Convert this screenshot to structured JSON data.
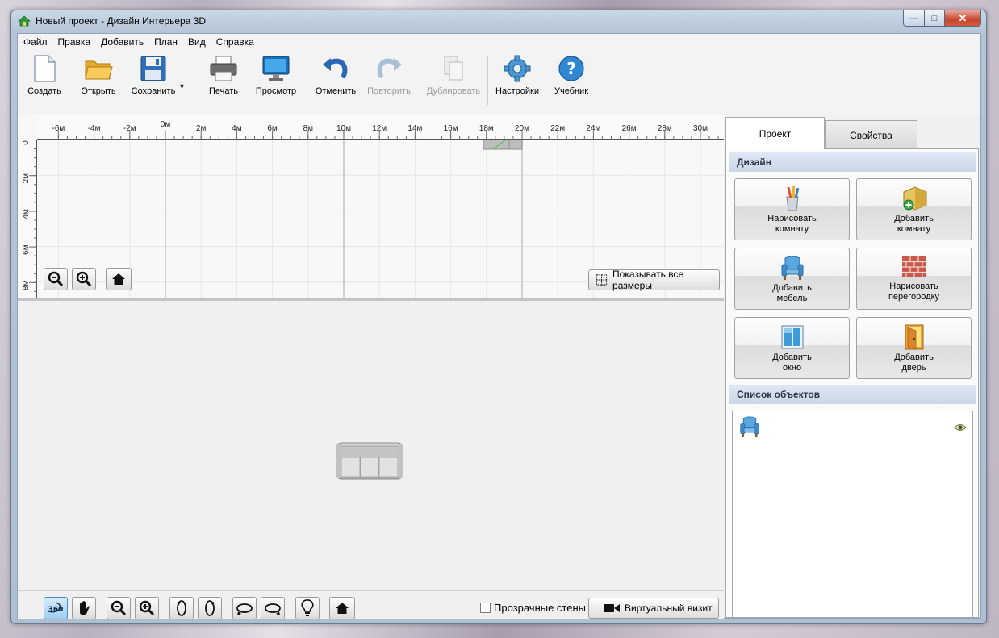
{
  "window": {
    "title": "Новый проект - Дизайн Интерьера 3D"
  },
  "menu": [
    "Файл",
    "Правка",
    "Добавить",
    "План",
    "Вид",
    "Справка"
  ],
  "toolbar": {
    "create": "Создать",
    "open": "Открыть",
    "save": "Сохранить",
    "print": "Печать",
    "preview": "Просмотр",
    "undo": "Отменить",
    "redo": "Повторить",
    "duplicate": "Дублировать",
    "settings": "Настройки",
    "tutorial": "Учебник"
  },
  "plan": {
    "ruler_top": [
      "-6м",
      "-4м",
      "-2м",
      "0м",
      "2м",
      "4м",
      "6м",
      "8м",
      "10м",
      "12м",
      "14м",
      "16м",
      "18м",
      "20м",
      "22м",
      "24м",
      "26м",
      "28м",
      "30м"
    ],
    "ruler_left": [
      "0",
      "2м",
      "4м",
      "6м",
      "8м"
    ],
    "show_dimensions": "Показывать все размеры"
  },
  "view3d": {
    "transparent_walls": "Прозрачные стены",
    "virtual_visit": "Виртуальный визит",
    "rotate_360": "360"
  },
  "panel": {
    "tab_project": "Проект",
    "tab_properties": "Свойства",
    "design_header": "Дизайн",
    "buttons": [
      {
        "line1": "Нарисовать",
        "line2": "комнату",
        "icon": "pencils-icon"
      },
      {
        "line1": "Добавить",
        "line2": "комнату",
        "icon": "add-room-icon"
      },
      {
        "line1": "Добавить",
        "line2": "мебель",
        "icon": "armchair-icon"
      },
      {
        "line1": "Нарисовать",
        "line2": "перегородку",
        "icon": "brick-wall-icon"
      },
      {
        "line1": "Добавить",
        "line2": "окно",
        "icon": "window-icon"
      },
      {
        "line1": "Добавить",
        "line2": "дверь",
        "icon": "door-icon"
      }
    ],
    "objects_header": "Список объектов"
  },
  "colors": {
    "accent": "#3b86c8",
    "section_header": "#c9d7e6",
    "close_button": "#c8452c"
  }
}
